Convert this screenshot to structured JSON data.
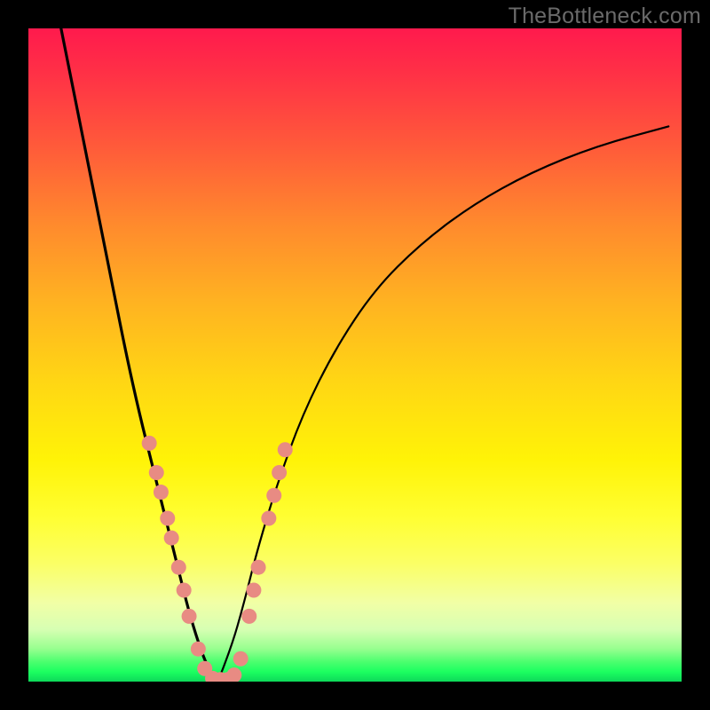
{
  "watermark": "TheBottleneck.com",
  "colors": {
    "frame": "#000000",
    "curve": "#000000",
    "marker_fill": "#e88b83",
    "marker_stroke": "#d16f66"
  },
  "chart_data": {
    "type": "line",
    "title": "",
    "xlabel": "",
    "ylabel": "",
    "xlim": [
      0,
      100
    ],
    "ylim": [
      0,
      100
    ],
    "note": "V-shaped bottleneck curve over rainbow gradient; axes unlabeled. x/y values are estimated from pixel positions (0–100 normalized).",
    "series": [
      {
        "name": "left_branch",
        "x": [
          5,
          7,
          9,
          11,
          13,
          15,
          17,
          19,
          21,
          23,
          24.5,
          26,
          27.5,
          29
        ],
        "y": [
          100,
          90,
          80,
          70,
          60,
          50,
          41,
          33,
          25,
          17,
          11,
          6,
          2,
          0
        ]
      },
      {
        "name": "right_branch",
        "x": [
          29,
          31,
          33,
          35,
          38,
          42,
          47,
          53,
          60,
          68,
          77,
          87,
          98
        ],
        "y": [
          0,
          5,
          12,
          20,
          30,
          41,
          51,
          60,
          67,
          73,
          78,
          82,
          85
        ]
      }
    ],
    "markers": [
      {
        "x": 18.5,
        "y": 36.5
      },
      {
        "x": 19.6,
        "y": 32.0
      },
      {
        "x": 20.3,
        "y": 29.0
      },
      {
        "x": 21.3,
        "y": 25.0
      },
      {
        "x": 21.9,
        "y": 22.0
      },
      {
        "x": 23.0,
        "y": 17.5
      },
      {
        "x": 23.8,
        "y": 14.0
      },
      {
        "x": 24.6,
        "y": 10.0
      },
      {
        "x": 26.0,
        "y": 5.0
      },
      {
        "x": 27.0,
        "y": 2.0
      },
      {
        "x": 28.2,
        "y": 0.5
      },
      {
        "x": 29.4,
        "y": 0.3
      },
      {
        "x": 30.5,
        "y": 0.3
      },
      {
        "x": 31.5,
        "y": 1.0
      },
      {
        "x": 32.5,
        "y": 3.5
      },
      {
        "x": 33.8,
        "y": 10.0
      },
      {
        "x": 34.5,
        "y": 14.0
      },
      {
        "x": 35.2,
        "y": 17.5
      },
      {
        "x": 36.8,
        "y": 25.0
      },
      {
        "x": 37.6,
        "y": 28.5
      },
      {
        "x": 38.4,
        "y": 32.0
      },
      {
        "x": 39.3,
        "y": 35.5
      }
    ]
  }
}
